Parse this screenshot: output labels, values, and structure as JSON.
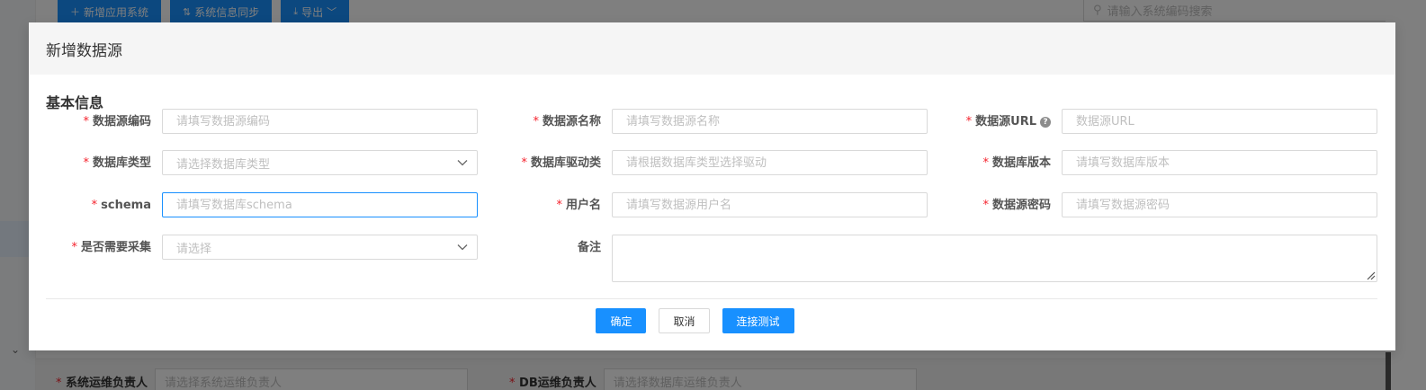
{
  "background": {
    "toolbar": [
      {
        "icon": "plus-icon",
        "label": "新增应用系统"
      },
      {
        "icon": "sync-icon",
        "label": "系统信息同步"
      },
      {
        "icon": "download-icon",
        "label": "导出"
      }
    ],
    "search_placeholder": "请输入系统编码搜索",
    "bottom_fields": [
      {
        "label": "系统运维负责人",
        "placeholder": "请选择系统运维负责人"
      },
      {
        "label": "DB运维负责人",
        "placeholder": "请选择数据库运维负责人"
      }
    ]
  },
  "modal": {
    "title": "新增数据源",
    "section_title": "基本信息",
    "fields": {
      "code": {
        "label": "数据源编码",
        "placeholder": "请填写数据源编码",
        "required": true
      },
      "name": {
        "label": "数据源名称",
        "placeholder": "请填写数据源名称",
        "required": true
      },
      "url": {
        "label": "数据源URL",
        "placeholder": "数据源URL",
        "required": true,
        "help_icon": "question-circle-icon"
      },
      "db_type": {
        "label": "数据库类型",
        "placeholder": "请选择数据库类型",
        "required": true
      },
      "driver": {
        "label": "数据库驱动类",
        "placeholder": "请根据数据库类型选择驱动",
        "required": true
      },
      "db_version": {
        "label": "数据库版本",
        "placeholder": "请填写数据库版本",
        "required": true
      },
      "schema": {
        "label": "schema",
        "placeholder": "请填写数据库schema",
        "required": true
      },
      "username": {
        "label": "用户名",
        "placeholder": "请填写数据源用户名",
        "required": true
      },
      "password": {
        "label": "数据源密码",
        "placeholder": "请填写数据源密码",
        "required": true
      },
      "collect": {
        "label": "是否需要采集",
        "placeholder": "请选择",
        "required": true
      },
      "remark": {
        "label": "备注",
        "required": false
      }
    },
    "buttons": {
      "confirm": "确定",
      "cancel": "取消",
      "test": "连接测试"
    }
  },
  "colors": {
    "primary": "#1890ff",
    "required": "#f5222d",
    "placeholder": "#bfbfbf"
  }
}
